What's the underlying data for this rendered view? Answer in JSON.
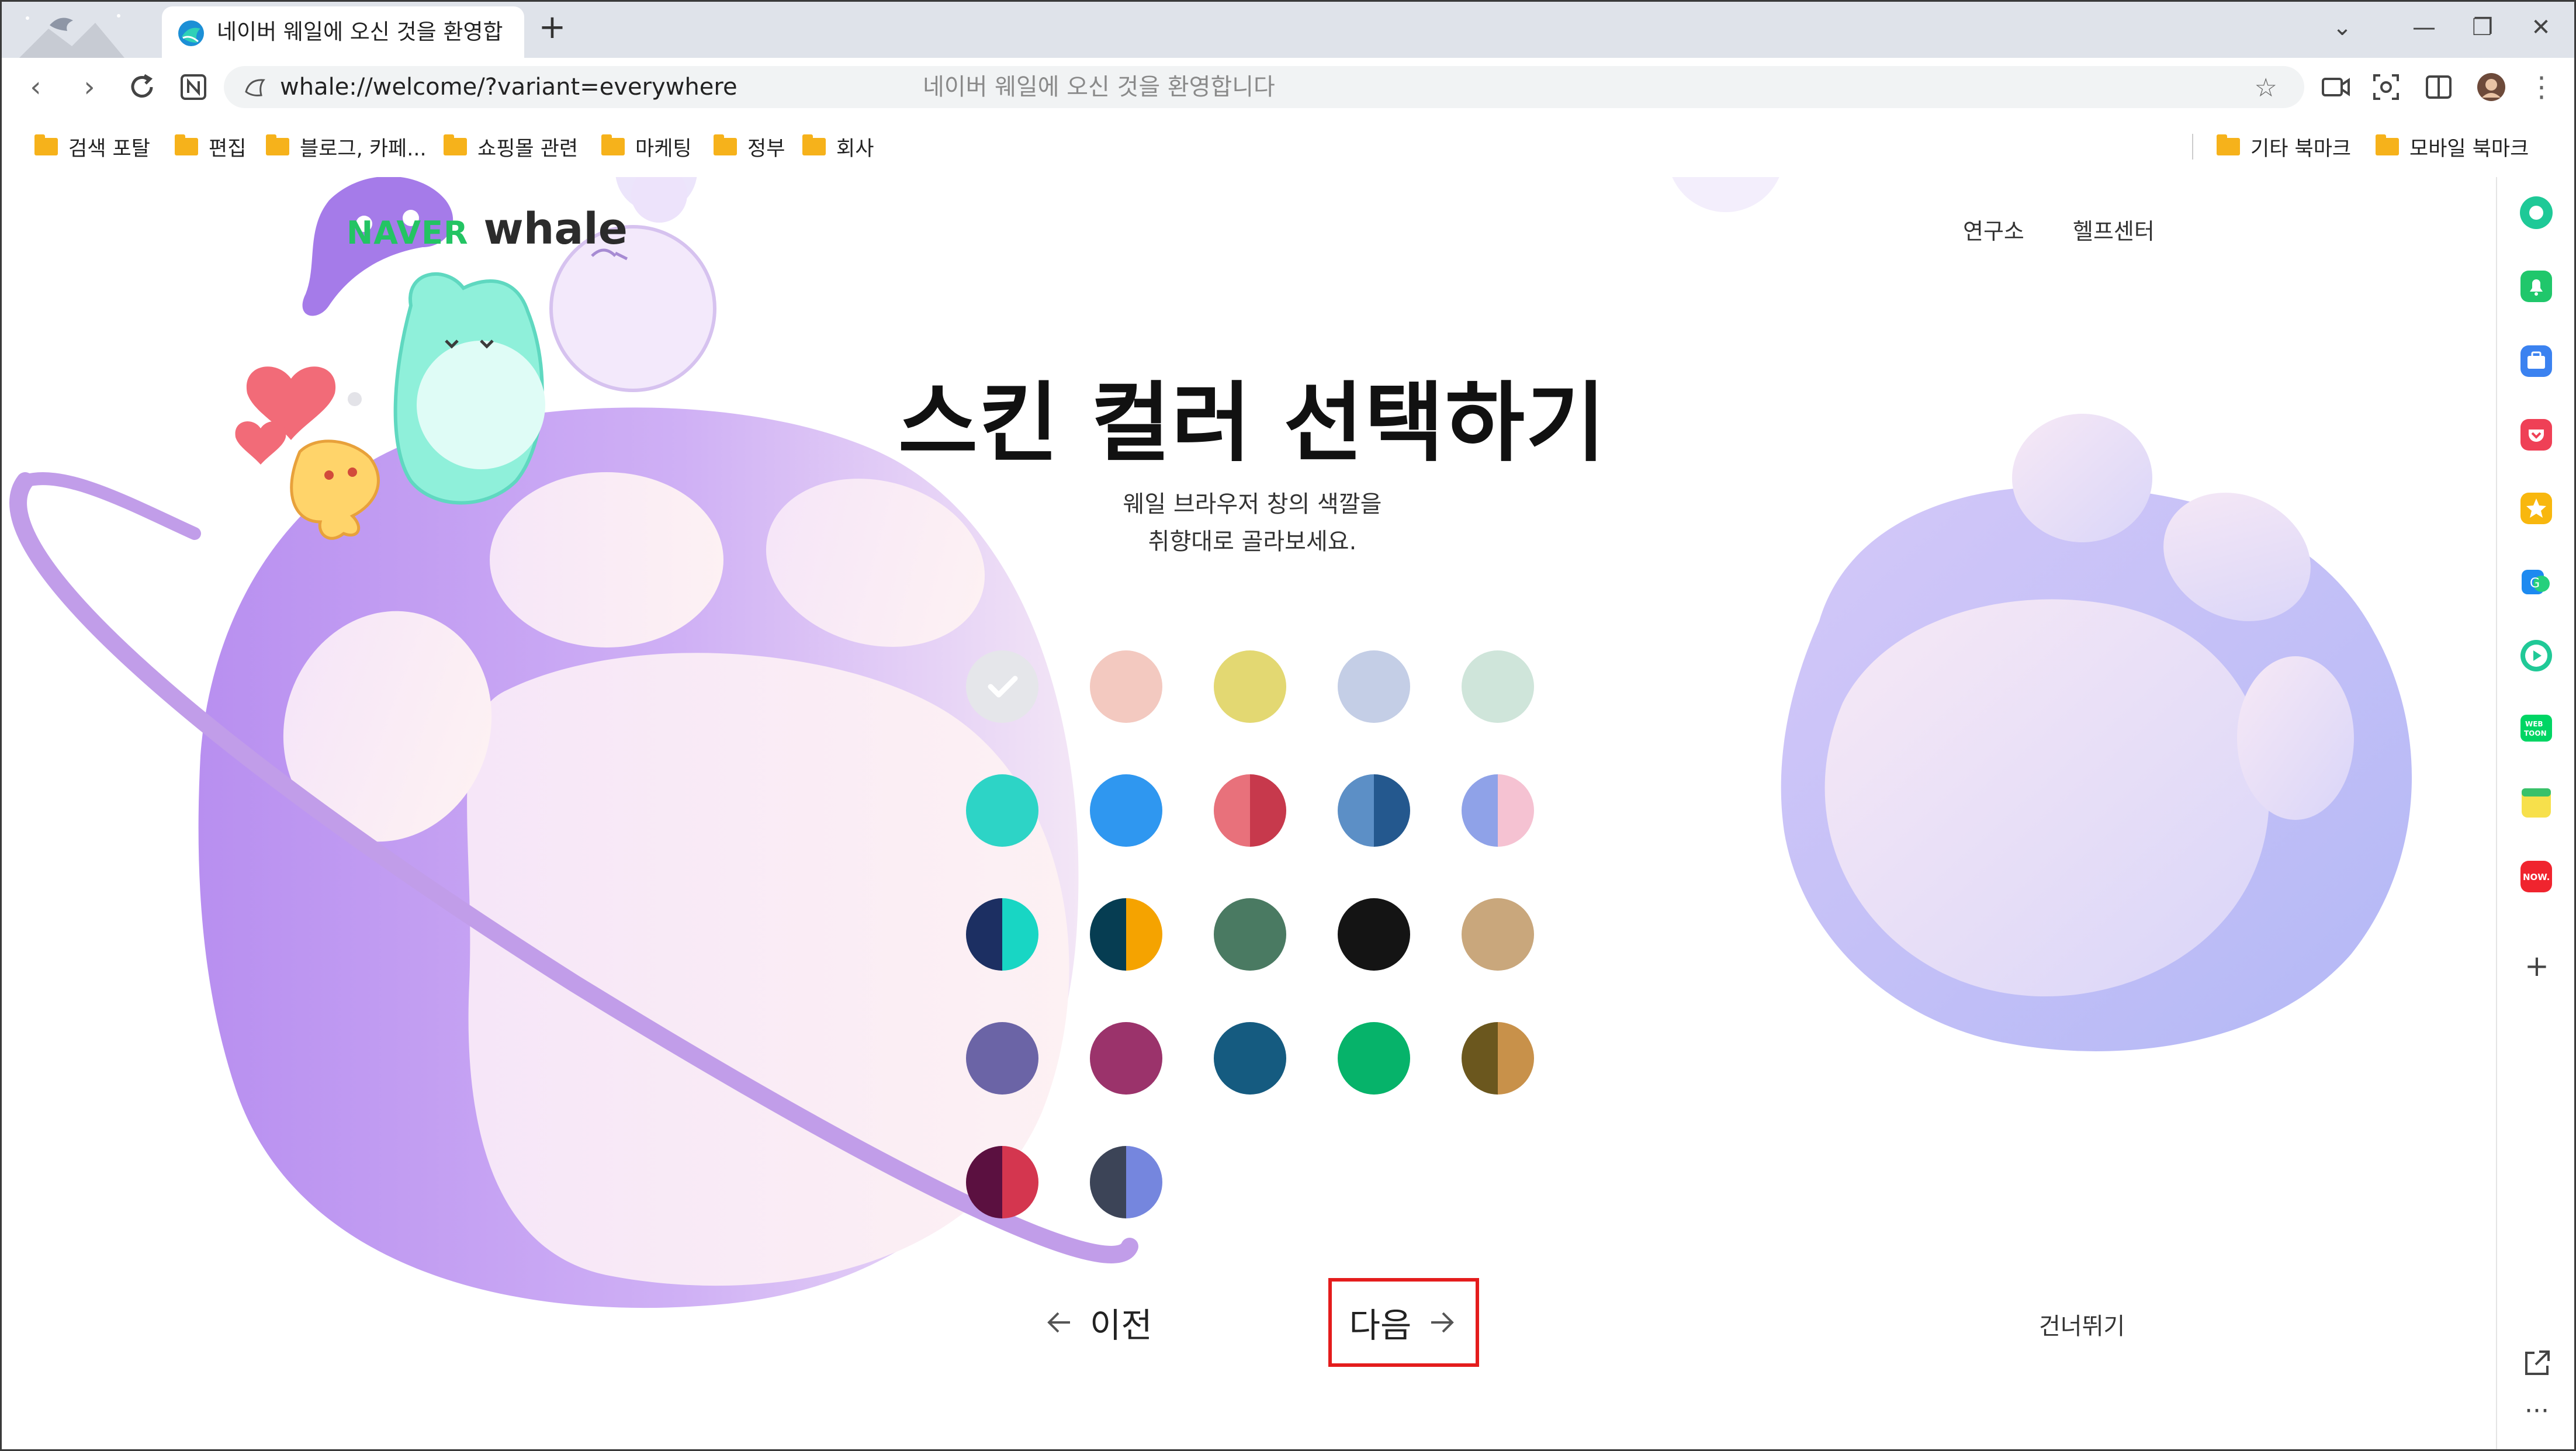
{
  "browser": {
    "tab": {
      "title": "네이버 웨일에 오신 것을 환영합니다"
    },
    "address_bar": {
      "url": "whale://welcome/?variant=everywhere",
      "page_title": "네이버 웨일에 오신 것을 환영합니다"
    },
    "bookmarks": [
      "검색 포탈",
      "편집",
      "블로그, 카페...",
      "쇼핑몰 관련",
      "마케팅",
      "정부",
      "회사"
    ],
    "bookmarks_right": [
      "기타 북마크",
      "모바일 북마크"
    ]
  },
  "page": {
    "logo": {
      "naver": "NAVER",
      "whale": "whale"
    },
    "top_links": [
      "연구소",
      "헬프센터"
    ],
    "heading": "스킨 컬러 선택하기",
    "subtitle_line1": "웨일 브라우저 창의 색깔을",
    "subtitle_line2": "취향대로 골라보세요.",
    "swatches": [
      {
        "colors": [
          "#e5e6ea"
        ],
        "selected": true
      },
      {
        "colors": [
          "#f3c9c0"
        ]
      },
      {
        "colors": [
          "#e3d872"
        ]
      },
      {
        "colors": [
          "#c4cee6"
        ]
      },
      {
        "colors": [
          "#cfe5da"
        ]
      },
      {
        "colors": [
          "#2dd4c6"
        ]
      },
      {
        "colors": [
          "#2f97f0"
        ]
      },
      {
        "colors": [
          "#e8717b",
          "#c7394c"
        ]
      },
      {
        "colors": [
          "#5c8fc6",
          "#24588e"
        ]
      },
      {
        "colors": [
          "#8fa2e8",
          "#f5c2d2"
        ]
      },
      {
        "colors": [
          "#1c2f62",
          "#18d6c4"
        ]
      },
      {
        "colors": [
          "#063d52",
          "#f5a300"
        ]
      },
      {
        "colors": [
          "#4a7a62"
        ]
      },
      {
        "colors": [
          "#141414"
        ]
      },
      {
        "colors": [
          "#c9a77c"
        ]
      },
      {
        "colors": [
          "#6b64a6"
        ]
      },
      {
        "colors": [
          "#9b336b"
        ]
      },
      {
        "colors": [
          "#155b80"
        ]
      },
      {
        "colors": [
          "#06b36a"
        ]
      },
      {
        "colors": [
          "#6b571e",
          "#c8914a"
        ]
      },
      {
        "colors": [
          "#5b1040",
          "#d4364f"
        ]
      },
      {
        "colors": [
          "#3c4457",
          "#7586de"
        ]
      }
    ],
    "prev_label": "이전",
    "next_label": "다음",
    "skip_label": "건너뛰기"
  }
}
